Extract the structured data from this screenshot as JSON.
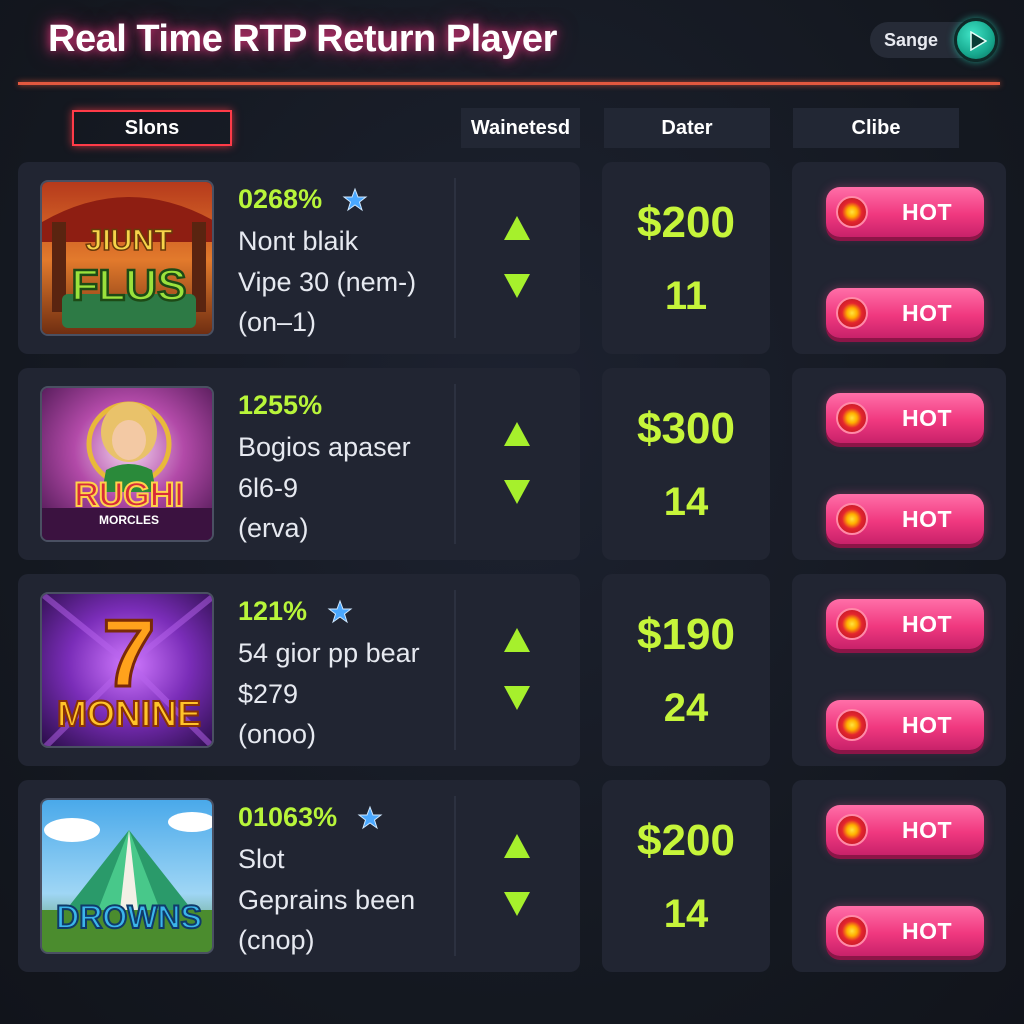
{
  "header": {
    "title": "Real Time RTP Return Player",
    "toggle_label": "Sange"
  },
  "columns": [
    "Slons",
    "Wainetesd",
    "Dater",
    "Clibe"
  ],
  "rows": [
    {
      "game": "JIUNT FLUS",
      "rtp": "0268%",
      "star": true,
      "line1": "Nont blaik",
      "line2": "Vipe 30 (nem-)",
      "line3": "(on–1)",
      "amount": "$200",
      "count": "11",
      "hot": [
        "HOT",
        "HOT"
      ]
    },
    {
      "game": "RUGHI MORCLES",
      "rtp": "1255%",
      "star": false,
      "line1": "Bogios apaser",
      "line2": "6l6-9",
      "line3": "(erva)",
      "amount": "$300",
      "count": "14",
      "hot": [
        "HOT",
        "HOT"
      ]
    },
    {
      "game": "7 MONINE",
      "rtp": "121%",
      "star": true,
      "line1": "54 gior pp bear",
      "line2": "$279",
      "line3": "(onoo)",
      "amount": "$190",
      "count": "24",
      "hot": [
        "HOT",
        "HOT"
      ]
    },
    {
      "game": "DROWNS",
      "rtp": "01063%",
      "star": true,
      "line1": "Slot",
      "line2": "Geprains been",
      "line3": "(cnop)",
      "amount": "$200",
      "count": "14",
      "hot": [
        "HOT",
        "HOT"
      ]
    }
  ],
  "colors": {
    "accent_green": "#b8f53a",
    "hot_pink": "#f0387f",
    "title_glow": "#ff3c8c",
    "divider": "#e2583f"
  },
  "icons": {
    "star": "star-icon",
    "up": "arrow-up-icon",
    "down": "arrow-down-icon",
    "play": "play-icon",
    "hot_dot": "hot-dot-icon"
  }
}
